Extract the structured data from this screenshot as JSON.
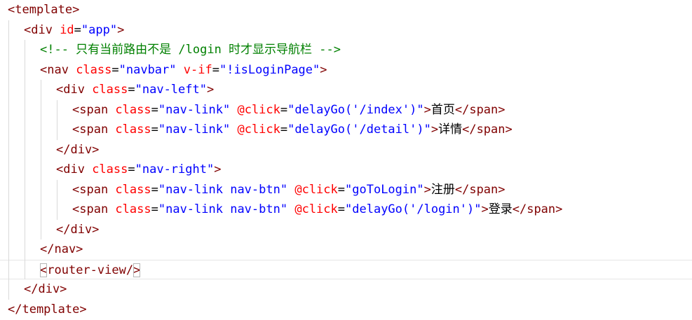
{
  "colors": {
    "tag": "#800000",
    "attr": "#ff0000",
    "value": "#0000ff",
    "comment": "#008000",
    "text": "#000000",
    "guide": "#d9d9d9",
    "current_line_border": "#e6e6e6"
  },
  "lines": [
    {
      "indent": 0,
      "tokens": [
        {
          "t": "<template>",
          "c": "tag"
        }
      ]
    },
    {
      "indent": 1,
      "tokens": [
        {
          "t": "<div ",
          "c": "tag"
        },
        {
          "t": "id",
          "c": "attr"
        },
        {
          "t": "=",
          "c": "text"
        },
        {
          "t": "\"app\"",
          "c": "value"
        },
        {
          "t": ">",
          "c": "tag"
        }
      ]
    },
    {
      "indent": 2,
      "tokens": [
        {
          "t": "<!-- 只有当前路由不是 /login 时才显示导航栏 -->",
          "c": "comment"
        }
      ]
    },
    {
      "indent": 2,
      "tokens": [
        {
          "t": "<nav ",
          "c": "tag"
        },
        {
          "t": "class",
          "c": "attr"
        },
        {
          "t": "=",
          "c": "text"
        },
        {
          "t": "\"navbar\"",
          "c": "value"
        },
        {
          "t": " ",
          "c": "text"
        },
        {
          "t": "v-if",
          "c": "attr"
        },
        {
          "t": "=",
          "c": "text"
        },
        {
          "t": "\"!isLoginPage\"",
          "c": "value"
        },
        {
          "t": ">",
          "c": "tag"
        }
      ]
    },
    {
      "indent": 3,
      "tokens": [
        {
          "t": "<div ",
          "c": "tag"
        },
        {
          "t": "class",
          "c": "attr"
        },
        {
          "t": "=",
          "c": "text"
        },
        {
          "t": "\"nav-left\"",
          "c": "value"
        },
        {
          "t": ">",
          "c": "tag"
        }
      ]
    },
    {
      "indent": 4,
      "tokens": [
        {
          "t": "<span ",
          "c": "tag"
        },
        {
          "t": "class",
          "c": "attr"
        },
        {
          "t": "=",
          "c": "text"
        },
        {
          "t": "\"nav-link\"",
          "c": "value"
        },
        {
          "t": " ",
          "c": "text"
        },
        {
          "t": "@click",
          "c": "attr"
        },
        {
          "t": "=",
          "c": "text"
        },
        {
          "t": "\"delayGo('/index')\"",
          "c": "value"
        },
        {
          "t": ">",
          "c": "tag"
        },
        {
          "t": "首页",
          "c": "text"
        },
        {
          "t": "</span>",
          "c": "tag"
        }
      ]
    },
    {
      "indent": 4,
      "tokens": [
        {
          "t": "<span ",
          "c": "tag"
        },
        {
          "t": "class",
          "c": "attr"
        },
        {
          "t": "=",
          "c": "text"
        },
        {
          "t": "\"nav-link\"",
          "c": "value"
        },
        {
          "t": " ",
          "c": "text"
        },
        {
          "t": "@click",
          "c": "attr"
        },
        {
          "t": "=",
          "c": "text"
        },
        {
          "t": "\"delayGo('/detail')\"",
          "c": "value"
        },
        {
          "t": ">",
          "c": "tag"
        },
        {
          "t": "详情",
          "c": "text"
        },
        {
          "t": "</span>",
          "c": "tag"
        }
      ]
    },
    {
      "indent": 3,
      "tokens": [
        {
          "t": "</div>",
          "c": "tag"
        }
      ]
    },
    {
      "indent": 3,
      "tokens": [
        {
          "t": "<div ",
          "c": "tag"
        },
        {
          "t": "class",
          "c": "attr"
        },
        {
          "t": "=",
          "c": "text"
        },
        {
          "t": "\"nav-right\"",
          "c": "value"
        },
        {
          "t": ">",
          "c": "tag"
        }
      ]
    },
    {
      "indent": 4,
      "tokens": [
        {
          "t": "<span ",
          "c": "tag"
        },
        {
          "t": "class",
          "c": "attr"
        },
        {
          "t": "=",
          "c": "text"
        },
        {
          "t": "\"nav-link nav-btn\"",
          "c": "value"
        },
        {
          "t": " ",
          "c": "text"
        },
        {
          "t": "@click",
          "c": "attr"
        },
        {
          "t": "=",
          "c": "text"
        },
        {
          "t": "\"goToLogin\"",
          "c": "value"
        },
        {
          "t": ">",
          "c": "tag"
        },
        {
          "t": "注册",
          "c": "text"
        },
        {
          "t": "</span>",
          "c": "tag"
        }
      ]
    },
    {
      "indent": 4,
      "tokens": [
        {
          "t": "<span ",
          "c": "tag"
        },
        {
          "t": "class",
          "c": "attr"
        },
        {
          "t": "=",
          "c": "text"
        },
        {
          "t": "\"nav-link nav-btn\"",
          "c": "value"
        },
        {
          "t": " ",
          "c": "text"
        },
        {
          "t": "@click",
          "c": "attr"
        },
        {
          "t": "=",
          "c": "text"
        },
        {
          "t": "\"delayGo('/login')\"",
          "c": "value"
        },
        {
          "t": ">",
          "c": "tag"
        },
        {
          "t": "登录",
          "c": "text"
        },
        {
          "t": "</span>",
          "c": "tag"
        }
      ]
    },
    {
      "indent": 3,
      "tokens": [
        {
          "t": "</div>",
          "c": "tag"
        }
      ]
    },
    {
      "indent": 2,
      "tokens": [
        {
          "t": "</nav>",
          "c": "tag"
        }
      ]
    },
    {
      "indent": 2,
      "current": true,
      "tokens": [
        {
          "t": "<",
          "c": "tag",
          "box": true
        },
        {
          "t": "router-view/",
          "c": "tag"
        },
        {
          "t": ">",
          "c": "tag",
          "box": true
        }
      ]
    },
    {
      "indent": 1,
      "tokens": [
        {
          "t": "</div>",
          "c": "tag"
        }
      ]
    },
    {
      "indent": 0,
      "tokens": [
        {
          "t": "</template>",
          "c": "tag"
        }
      ]
    }
  ]
}
